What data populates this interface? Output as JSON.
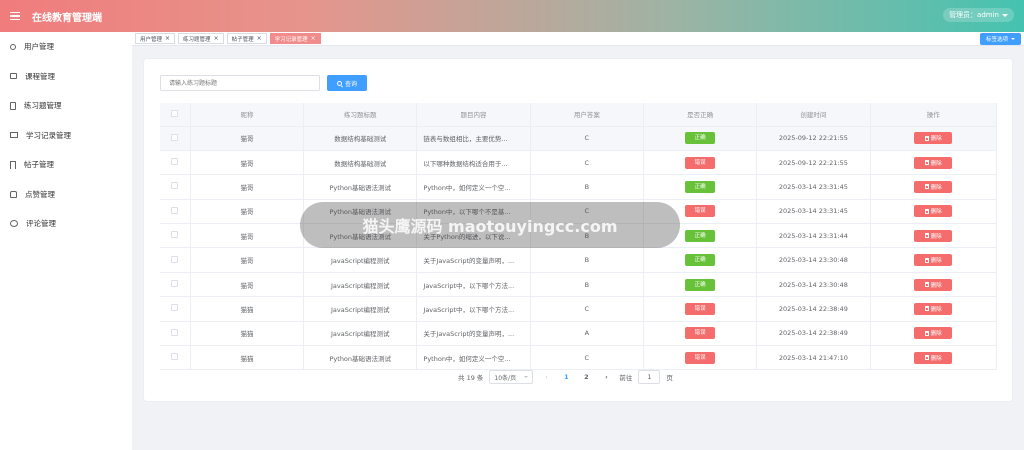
{
  "header": {
    "title": "在线教育管理端",
    "admin_label": "管理员：admin"
  },
  "sidebar": {
    "items": [
      {
        "label": "用户管理",
        "icon": "user-icon"
      },
      {
        "label": "课程管理",
        "icon": "course-icon"
      },
      {
        "label": "练习题管理",
        "icon": "document-icon"
      },
      {
        "label": "学习记录管理",
        "icon": "book-icon"
      },
      {
        "label": "帖子管理",
        "icon": "bookmark-icon"
      },
      {
        "label": "点赞管理",
        "icon": "like-icon"
      },
      {
        "label": "评论管理",
        "icon": "comment-icon"
      }
    ]
  },
  "tabs": [
    {
      "label": "用户管理",
      "active": false
    },
    {
      "label": "练习题管理",
      "active": false
    },
    {
      "label": "帖子管理",
      "active": false
    },
    {
      "label": "学习记录管理",
      "active": true
    }
  ],
  "tab_options_label": "标签选项",
  "search": {
    "placeholder": "请输入练习题标题",
    "button_label": "查询"
  },
  "table": {
    "headers": [
      "昵称",
      "练习题标题",
      "题目内容",
      "用户答案",
      "是否正确",
      "创建时间",
      "操作"
    ],
    "delete_label": "删除",
    "rows": [
      {
        "nickname": "猫哥",
        "title": "数据结构基础测试",
        "content": "链表与数组相比，主要优势...",
        "answer": "C",
        "correct": "正确",
        "time": "2025-09-12 22:21:55"
      },
      {
        "nickname": "猫哥",
        "title": "数据结构基础测试",
        "content": "以下哪种数据结构适合用于...",
        "answer": "C",
        "correct": "错误",
        "time": "2025-09-12 22:21:55"
      },
      {
        "nickname": "猫哥",
        "title": "Python基础语法测试",
        "content": "Python中，如何定义一个空...",
        "answer": "B",
        "correct": "正确",
        "time": "2025-03-14 23:31:45"
      },
      {
        "nickname": "猫哥",
        "title": "Python基础语法测试",
        "content": "Python中，以下哪个不是基...",
        "answer": "C",
        "correct": "错误",
        "time": "2025-03-14 23:31:45"
      },
      {
        "nickname": "猫哥",
        "title": "Python基础语法测试",
        "content": "关于Python的缩进，以下说...",
        "answer": "B",
        "correct": "正确",
        "time": "2025-03-14 23:31:44"
      },
      {
        "nickname": "猫哥",
        "title": "JavaScript编程测试",
        "content": "关于JavaScript的变量声明，...",
        "answer": "B",
        "correct": "正确",
        "time": "2025-03-14 23:30:48"
      },
      {
        "nickname": "猫哥",
        "title": "JavaScript编程测试",
        "content": "JavaScript中，以下哪个方法...",
        "answer": "B",
        "correct": "正确",
        "time": "2025-03-14 23:30:48"
      },
      {
        "nickname": "猫猫",
        "title": "JavaScript编程测试",
        "content": "JavaScript中，以下哪个方法...",
        "answer": "C",
        "correct": "错误",
        "time": "2025-03-14 22:38:49"
      },
      {
        "nickname": "猫猫",
        "title": "JavaScript编程测试",
        "content": "关于JavaScript的变量声明，...",
        "answer": "A",
        "correct": "错误",
        "time": "2025-03-14 22:38:49"
      },
      {
        "nickname": "猫猫",
        "title": "Python基础语法测试",
        "content": "Python中，如何定义一个空...",
        "answer": "C",
        "correct": "错误",
        "time": "2025-03-14 21:47:10"
      }
    ]
  },
  "pagination": {
    "total_label": "共 19 条",
    "page_size": "10条/页",
    "pages": [
      "1",
      "2"
    ],
    "current_page": "1",
    "goto_label": "前往",
    "goto_value": "1",
    "page_suffix": "页"
  },
  "watermark": {
    "text": "猫头鹰源码 maotouyingcc.com"
  },
  "colors": {
    "primary": "#409eff",
    "success": "#67c23a",
    "danger": "#f56c6c",
    "active_tab": "#f28b8b"
  }
}
